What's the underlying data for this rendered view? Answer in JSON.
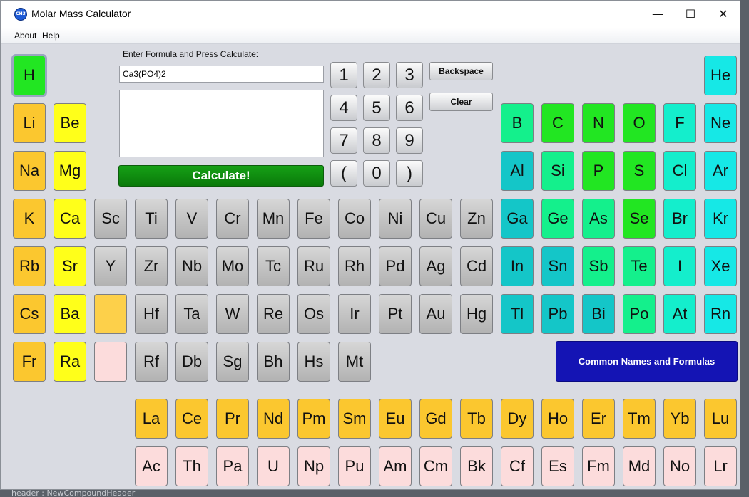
{
  "window": {
    "title": "Molar Mass Calculator",
    "icon_label": "CH3",
    "controls": {
      "minimize": "—",
      "maximize": "☐",
      "close": "✕"
    }
  },
  "menu": [
    "About",
    "Help"
  ],
  "formula_label": "Enter Formula and Press Calculate:",
  "formula_value": "Ca3(PO4)2",
  "output_value": "",
  "calculate_label": "Calculate!",
  "keypad": [
    "1",
    "2",
    "3",
    "4",
    "5",
    "6",
    "7",
    "8",
    "9",
    "(",
    "0",
    ")"
  ],
  "backspace_label": "Backspace",
  "clear_label": "Clear",
  "common_label": "Common Names and Formulas",
  "background_hint": "header : NewCompoundHeader",
  "colors": {
    "green": "#22e622",
    "orange": "#fbc72f",
    "yellow": "#ffff1a",
    "gray": "#c2c2c2",
    "teal": "#14c6c8",
    "seagreen": "#14f08c",
    "cyan": "#14eedc",
    "pink": "#fcdcdc",
    "button_blue": "#1414b4",
    "calc_green": "#0a8a0a"
  },
  "elements": [
    {
      "s": "H",
      "c": "#22e622",
      "sel": true
    },
    {
      "s": "He",
      "c": "#16e8e6"
    },
    {
      "s": "Li",
      "c": "#fbc72f"
    },
    {
      "s": "Be",
      "c": "#ffff1a"
    },
    {
      "s": "B",
      "c": "#14f08c"
    },
    {
      "s": "C",
      "c": "#22e622"
    },
    {
      "s": "N",
      "c": "#22e622"
    },
    {
      "s": "O",
      "c": "#22e622"
    },
    {
      "s": "F",
      "c": "#14eecc"
    },
    {
      "s": "Ne",
      "c": "#16e8e6"
    },
    {
      "s": "Na",
      "c": "#fbc72f"
    },
    {
      "s": "Mg",
      "c": "#ffff1a"
    },
    {
      "s": "Al",
      "c": "#14c6c8"
    },
    {
      "s": "Si",
      "c": "#14f08c"
    },
    {
      "s": "P",
      "c": "#22e622"
    },
    {
      "s": "S",
      "c": "#22e622"
    },
    {
      "s": "Cl",
      "c": "#14eecc"
    },
    {
      "s": "Ar",
      "c": "#16e8e6"
    },
    {
      "s": "K",
      "c": "#fbc72f"
    },
    {
      "s": "Ca",
      "c": "#ffff1a"
    },
    {
      "s": "Sc",
      "c": "#c2c2c2"
    },
    {
      "s": "Ti",
      "c": "#c2c2c2"
    },
    {
      "s": "V",
      "c": "#c2c2c2"
    },
    {
      "s": "Cr",
      "c": "#c2c2c2"
    },
    {
      "s": "Mn",
      "c": "#c2c2c2"
    },
    {
      "s": "Fe",
      "c": "#c2c2c2"
    },
    {
      "s": "Co",
      "c": "#c2c2c2"
    },
    {
      "s": "Ni",
      "c": "#c2c2c2"
    },
    {
      "s": "Cu",
      "c": "#c2c2c2"
    },
    {
      "s": "Zn",
      "c": "#c2c2c2"
    },
    {
      "s": "Ga",
      "c": "#14c6c8"
    },
    {
      "s": "Ge",
      "c": "#14f08c"
    },
    {
      "s": "As",
      "c": "#14f08c"
    },
    {
      "s": "Se",
      "c": "#22e622"
    },
    {
      "s": "Br",
      "c": "#14eecc"
    },
    {
      "s": "Kr",
      "c": "#16e8e6"
    },
    {
      "s": "Rb",
      "c": "#fbc72f"
    },
    {
      "s": "Sr",
      "c": "#ffff1a"
    },
    {
      "s": "Y",
      "c": "#c2c2c2"
    },
    {
      "s": "Zr",
      "c": "#c2c2c2"
    },
    {
      "s": "Nb",
      "c": "#c2c2c2"
    },
    {
      "s": "Mo",
      "c": "#c2c2c2"
    },
    {
      "s": "Tc",
      "c": "#c2c2c2"
    },
    {
      "s": "Ru",
      "c": "#c2c2c2"
    },
    {
      "s": "Rh",
      "c": "#c2c2c2"
    },
    {
      "s": "Pd",
      "c": "#c2c2c2"
    },
    {
      "s": "Ag",
      "c": "#c2c2c2"
    },
    {
      "s": "Cd",
      "c": "#c2c2c2"
    },
    {
      "s": "In",
      "c": "#14c6c8"
    },
    {
      "s": "Sn",
      "c": "#14c6c8"
    },
    {
      "s": "Sb",
      "c": "#14f08c"
    },
    {
      "s": "Te",
      "c": "#14f08c"
    },
    {
      "s": "I",
      "c": "#14eecc"
    },
    {
      "s": "Xe",
      "c": "#16e8e6"
    },
    {
      "s": "Cs",
      "c": "#fbc72f"
    },
    {
      "s": "Ba",
      "c": "#ffff1a"
    },
    {
      "s": "",
      "c": "#fdd04a"
    },
    {
      "s": "Hf",
      "c": "#c2c2c2"
    },
    {
      "s": "Ta",
      "c": "#c2c2c2"
    },
    {
      "s": "W",
      "c": "#c2c2c2"
    },
    {
      "s": "Re",
      "c": "#c2c2c2"
    },
    {
      "s": "Os",
      "c": "#c2c2c2"
    },
    {
      "s": "Ir",
      "c": "#c2c2c2"
    },
    {
      "s": "Pt",
      "c": "#c2c2c2"
    },
    {
      "s": "Au",
      "c": "#c2c2c2"
    },
    {
      "s": "Hg",
      "c": "#c2c2c2"
    },
    {
      "s": "Tl",
      "c": "#14c6c8"
    },
    {
      "s": "Pb",
      "c": "#14c6c8"
    },
    {
      "s": "Bi",
      "c": "#14c6c8"
    },
    {
      "s": "Po",
      "c": "#14f08c"
    },
    {
      "s": "At",
      "c": "#14eecc"
    },
    {
      "s": "Rn",
      "c": "#16e8e6"
    },
    {
      "s": "Fr",
      "c": "#fbc72f"
    },
    {
      "s": "Ra",
      "c": "#ffff1a"
    },
    {
      "s": "",
      "c": "#fcdcdc"
    },
    {
      "s": "Rf",
      "c": "#c2c2c2"
    },
    {
      "s": "Db",
      "c": "#c2c2c2"
    },
    {
      "s": "Sg",
      "c": "#c2c2c2"
    },
    {
      "s": "Bh",
      "c": "#c2c2c2"
    },
    {
      "s": "Hs",
      "c": "#c2c2c2"
    },
    {
      "s": "Mt",
      "c": "#c2c2c2"
    },
    {
      "s": "La",
      "c": "#fbc72f"
    },
    {
      "s": "Ce",
      "c": "#fbc72f"
    },
    {
      "s": "Pr",
      "c": "#fbc72f"
    },
    {
      "s": "Nd",
      "c": "#fbc72f"
    },
    {
      "s": "Pm",
      "c": "#fbc72f"
    },
    {
      "s": "Sm",
      "c": "#fbc72f"
    },
    {
      "s": "Eu",
      "c": "#fbc72f"
    },
    {
      "s": "Gd",
      "c": "#fbc72f"
    },
    {
      "s": "Tb",
      "c": "#fbc72f"
    },
    {
      "s": "Dy",
      "c": "#fbc72f"
    },
    {
      "s": "Ho",
      "c": "#fbc72f"
    },
    {
      "s": "Er",
      "c": "#fbc72f"
    },
    {
      "s": "Tm",
      "c": "#fbc72f"
    },
    {
      "s": "Yb",
      "c": "#fbc72f"
    },
    {
      "s": "Lu",
      "c": "#fbc72f"
    },
    {
      "s": "Ac",
      "c": "#fcdcdc"
    },
    {
      "s": "Th",
      "c": "#fcdcdc"
    },
    {
      "s": "Pa",
      "c": "#fcdcdc"
    },
    {
      "s": "U",
      "c": "#fcdcdc"
    },
    {
      "s": "Np",
      "c": "#fcdcdc"
    },
    {
      "s": "Pu",
      "c": "#fcdcdc"
    },
    {
      "s": "Am",
      "c": "#fcdcdc"
    },
    {
      "s": "Cm",
      "c": "#fcdcdc"
    },
    {
      "s": "Bk",
      "c": "#fcdcdc"
    },
    {
      "s": "Cf",
      "c": "#fcdcdc"
    },
    {
      "s": "Es",
      "c": "#fcdcdc"
    },
    {
      "s": "Fm",
      "c": "#fcdcdc"
    },
    {
      "s": "Md",
      "c": "#fcdcdc"
    },
    {
      "s": "No",
      "c": "#fcdcdc"
    },
    {
      "s": "Lr",
      "c": "#fcdcdc"
    }
  ]
}
